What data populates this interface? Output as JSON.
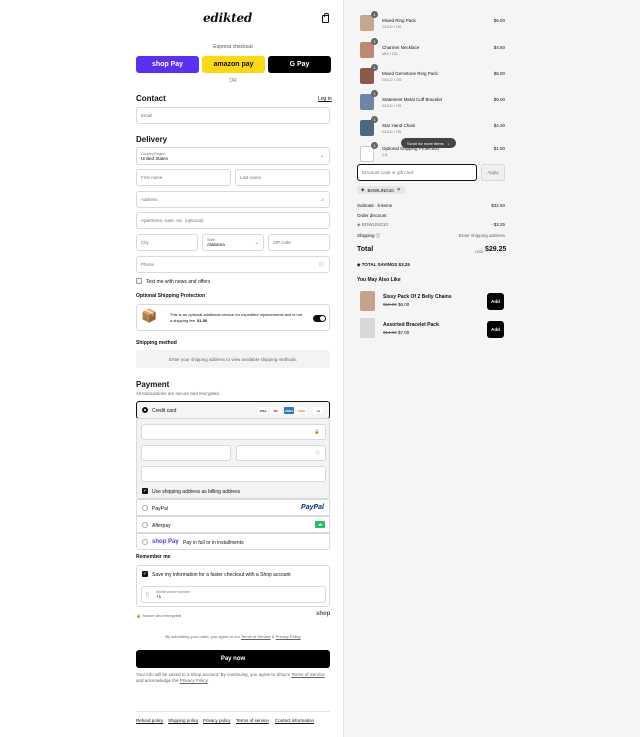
{
  "header": {
    "logo": "edikted"
  },
  "express": {
    "label": "Express checkout",
    "shop_pay": "shop Pay",
    "amazon_pay": "amazon pay",
    "google_pay": "G Pay",
    "or": "OR"
  },
  "contact": {
    "title": "Contact",
    "login": "Log in",
    "email_placeholder": "Email"
  },
  "delivery": {
    "title": "Delivery",
    "country_label": "Country/Region",
    "country_value": "United States",
    "first_name": "First name",
    "last_name": "Last name",
    "address": "Address",
    "apartment": "Apartment, suite, etc. (optional)",
    "city": "City",
    "state_label": "State",
    "state_value": "Alabama",
    "zip": "ZIP code",
    "phone": "Phone",
    "news": "Text me with news and offers"
  },
  "protection": {
    "title": "Optional Shipping Protection",
    "text": "This is an optional additional service for expedited replacements and is not a shipping fee.",
    "price": "$1.50"
  },
  "shipping": {
    "title": "Shipping method",
    "note": "Enter your shipping address to view available shipping methods."
  },
  "payment": {
    "title": "Payment",
    "subtitle": "All transactions are secure and encrypted.",
    "credit_card": "Credit card",
    "card_icons": [
      "VISA",
      "MC",
      "AMEX",
      "DISC",
      "+4"
    ],
    "billing": "Use shipping address as billing address",
    "paypal": "PayPal",
    "paypal_logo": "PayPal",
    "afterpay": "Afterpay",
    "shoppay_logo": "shop Pay",
    "shoppay": "Pay in full or in installments"
  },
  "remember": {
    "title": "Remember me",
    "save": "Save my information for a faster checkout with a Shop account",
    "phone_label": "Mobile phone number",
    "phone_value": "+1",
    "secure": "Secure and encrypted",
    "shop": "shop"
  },
  "terms": {
    "prefix": "By submitting your order, you agree to our",
    "tos": "Terms of Service",
    "amp": "&",
    "privacy": "Privacy Policy"
  },
  "pay_now": "Pay now",
  "shop_note": {
    "prefix": "Your info will be saved to a Shop account. By continuing, you agree to Shop's",
    "tos": "Terms of Service",
    "mid": "and acknowledge the",
    "privacy": "Privacy Policy",
    "suffix": "."
  },
  "footer": [
    "Refund policy",
    "Shipping policy",
    "Privacy policy",
    "Terms of service",
    "Contact information"
  ],
  "cart": {
    "items": [
      {
        "qty": "1",
        "name": "Mixed Ring Pack",
        "variant": "GOLD / OS",
        "price": "$6.00"
      },
      {
        "qty": "1",
        "name": "Charmer Necklace",
        "variant": "MIX / OS",
        "price": "$4.50"
      },
      {
        "qty": "1",
        "name": "Mixed Gemstone Ring Pack",
        "variant": "GOLD / OS",
        "price": "$8.00"
      },
      {
        "qty": "1",
        "name": "Statement Metal Cuff Bracelet",
        "variant": "GOLD / OS",
        "price": "$9.00"
      },
      {
        "qty": "1",
        "name": "Star Hand Chain",
        "variant": "GOLD / OS",
        "price": "$4.00"
      },
      {
        "qty": "1",
        "name": "Optional Shipping Protection",
        "variant": "1.5",
        "price": "$1.50"
      }
    ],
    "scroll_hint": "Scroll for more items",
    "discount_placeholder": "Discount code or gift card",
    "apply": "Apply",
    "code": "BOWLING10",
    "subtotal_label": "Subtotal · 6 items",
    "subtotal": "$32.50",
    "order_discount": "Order discount",
    "discount_code": "BOWLING10",
    "discount_amount": "- $3.25",
    "shipping_label": "Shipping",
    "shipping_value": "Enter shipping address",
    "total_label": "Total",
    "currency": "USD",
    "total": "$29.25",
    "savings_label": "TOTAL SAVINGS",
    "savings": "$3.25"
  },
  "upsell": {
    "title": "You May Also Like",
    "items": [
      {
        "name": "Sissy Pack Of 2 Belly Chains",
        "old": "$12.00",
        "new": "$6.00",
        "btn": "Add"
      },
      {
        "name": "Assorted Bracelet Pack",
        "old": "$14.00",
        "new": "$7.00",
        "btn": "Add"
      }
    ]
  },
  "colors": {
    "accent": "#000000",
    "shop": "#5a31f4",
    "amazon": "#ffd814",
    "afterpay": "#b2fce4"
  }
}
